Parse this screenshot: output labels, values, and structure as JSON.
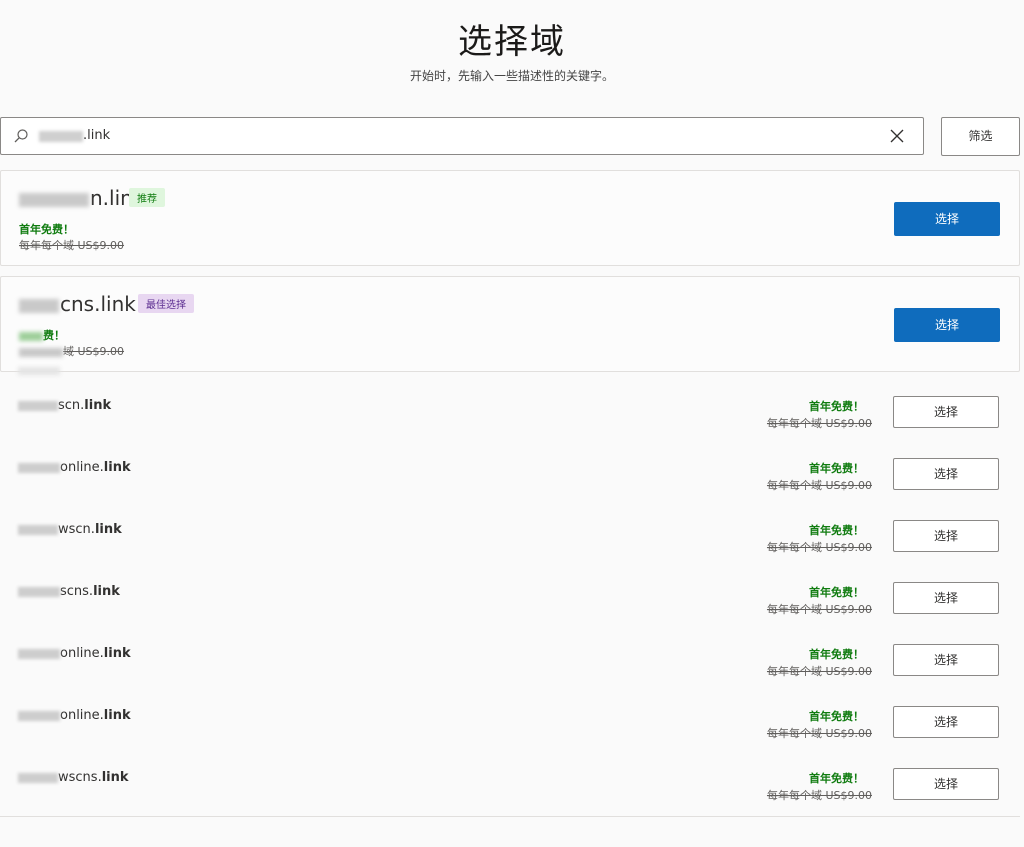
{
  "header": {
    "title": "选择域",
    "subtitle": "开始时，先输入一些描述性的关键字。"
  },
  "search": {
    "value": ".link",
    "filter_label": "筛选"
  },
  "featured": [
    {
      "name_suffix": "n.link",
      "badge": "推荐",
      "badge_color": "#107c10",
      "free_text": "首年免费！",
      "price_text": "每年每个域 US$9.00",
      "button_label": "选择"
    },
    {
      "name_suffix": "cns.link",
      "badge": "最佳选择",
      "badge_color": "#5c2e91",
      "free_text": "费！",
      "price_text": "域 US$9.00",
      "button_label": "选择"
    }
  ],
  "results": [
    {
      "name_suffix": "scn.",
      "tld": "link",
      "free_text": "首年免费！",
      "price_text": "每年每个域 US$9.00",
      "button_label": "选择"
    },
    {
      "name_suffix": "online.",
      "tld": "link",
      "free_text": "首年免费！",
      "price_text": "每年每个域 US$9.00",
      "button_label": "选择"
    },
    {
      "name_suffix": "wscn.",
      "tld": "link",
      "free_text": "首年免费！",
      "price_text": "每年每个域 US$9.00",
      "button_label": "选择"
    },
    {
      "name_suffix": "scns.",
      "tld": "link",
      "free_text": "首年免费！",
      "price_text": "每年每个域 US$9.00",
      "button_label": "选择"
    },
    {
      "name_suffix": "online.",
      "tld": "link",
      "free_text": "首年免费！",
      "price_text": "每年每个域 US$9.00",
      "button_label": "选择"
    },
    {
      "name_suffix": "online.",
      "tld": "link",
      "free_text": "首年免费！",
      "price_text": "每年每个域 US$9.00",
      "button_label": "选择"
    },
    {
      "name_suffix": "wscns.",
      "tld": "link",
      "free_text": "首年免费！",
      "price_text": "每年每个域 US$9.00",
      "button_label": "选择"
    }
  ],
  "colors": {
    "primary": "#0f6cbd",
    "success": "#107c10"
  }
}
